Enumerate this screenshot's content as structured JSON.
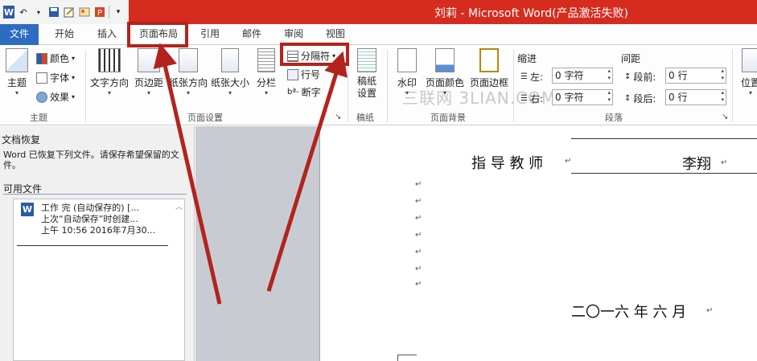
{
  "window": {
    "title": "刘莉 - Microsoft Word(产品激活失败)"
  },
  "tabs": [
    "文件",
    "开始",
    "插入",
    "页面布局",
    "引用",
    "邮件",
    "审阅",
    "视图"
  ],
  "ribbon": {
    "theme": {
      "themes_label": "主题",
      "colors_label": "颜色",
      "fonts_label": "字体",
      "effects_label": "效果",
      "group_label": "主题"
    },
    "page_setup": {
      "text_direction": "文字方向",
      "margins": "页边距",
      "orientation": "纸张方向",
      "size": "纸张大小",
      "columns": "分栏",
      "breaks": "分隔符",
      "line_numbers": "行号",
      "hyphenation": "断字",
      "group_label": "页面设置"
    },
    "manuscript": {
      "label": "稿纸\n设置",
      "group_label": "稿纸"
    },
    "page_background": {
      "watermark": "水印",
      "page_color": "页面颜色",
      "page_border": "页面边框",
      "group_label": "页面背景"
    },
    "paragraph": {
      "indent_label": "缩进",
      "spacing_label": "间距",
      "left_label": "左:",
      "left_value": "0 字符",
      "right_label": "右:",
      "right_value": "0 字符",
      "before_label": "段前:",
      "before_value": "0 行",
      "after_label": "段后:",
      "after_value": "0 行",
      "group_label": "段落"
    },
    "arrange": {
      "position": "位置"
    }
  },
  "watermark_text": "三联网 3LIAN.COM",
  "recovery": {
    "title": "文档恢复",
    "message": "Word 已恢复下列文件。请保存希望保留的文件。",
    "available_label": "可用文件",
    "file": {
      "line1": "工作 完 (自动保存的) [...",
      "line2": "上次“自动保存”时创建...",
      "line3": "上午 10:56 2016年7月30..."
    }
  },
  "document": {
    "advisor_label": "指 导 教 师",
    "advisor_name": "李翔",
    "date": "二〇一六 年 六 月"
  },
  "colors": {
    "titlebar": "#d62b1f",
    "file_tab": "#2d6cc0",
    "annotation": "#b3231d"
  }
}
